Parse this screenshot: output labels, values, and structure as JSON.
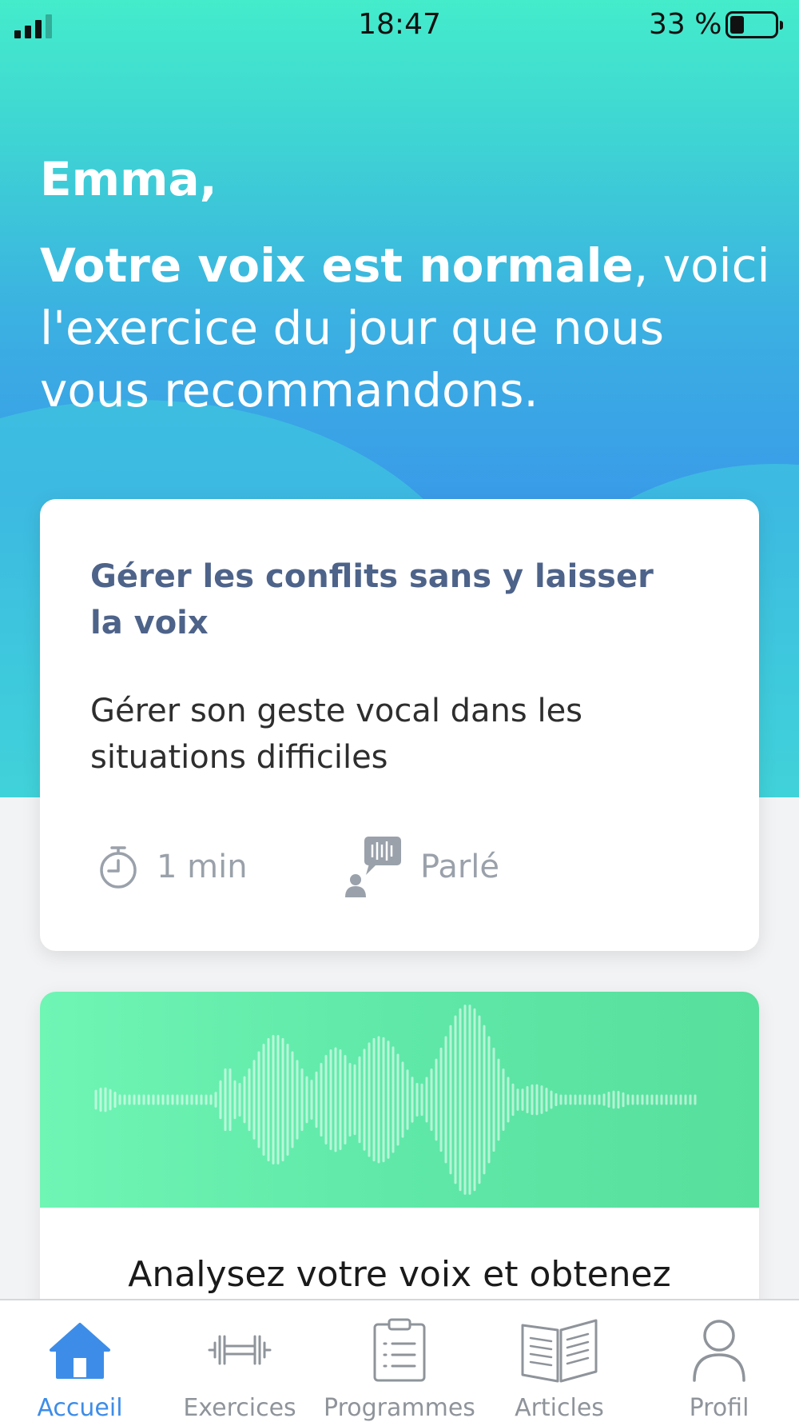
{
  "status_bar": {
    "time": "18:47",
    "battery": "33 %",
    "battery_level": 0.33
  },
  "greeting": {
    "name": "Emma,",
    "status_bold": "Votre voix est normale",
    "message": ", voici l'exercice du jour que nous vous recommandons."
  },
  "exercise_card": {
    "title": "Gérer les conflits sans y laisser la voix",
    "subtitle": "Gérer son geste vocal dans les situations difficiles",
    "duration": "1 min",
    "type": "Parlé",
    "icons": [
      "timer-icon",
      "speaking-person-icon"
    ]
  },
  "voice_card": {
    "text": "Analysez votre voix et obtenez"
  },
  "tab_bar": {
    "tabs": [
      {
        "label": "Accueil",
        "icon": "home-icon",
        "active": true
      },
      {
        "label": "Exercices",
        "icon": "dumbbell-icon",
        "active": false
      },
      {
        "label": "Programmes",
        "icon": "clipboard-list-icon",
        "active": false
      },
      {
        "label": "Articles",
        "icon": "open-book-icon",
        "active": false
      },
      {
        "label": "Profil",
        "icon": "user-icon",
        "active": false
      }
    ]
  },
  "colors": {
    "accent": "#3d8de8",
    "card_title": "#4e6389",
    "inactive_tab": "#8f949b",
    "voice_green": "#5fe8a8"
  }
}
